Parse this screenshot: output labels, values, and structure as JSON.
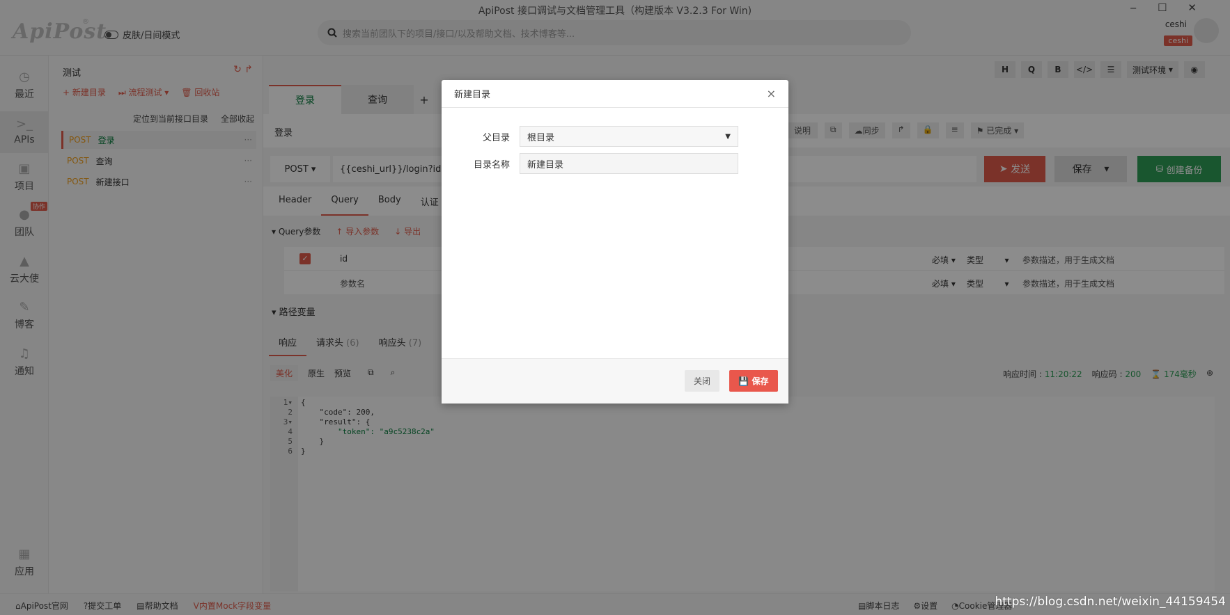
{
  "window": {
    "title": "ApiPost 接口调试与文档管理工具（构建版本 V3.2.3 For Win)",
    "controls": [
      "‒",
      "☐",
      "✕"
    ]
  },
  "header": {
    "logo": "ApiPost",
    "logo_mark": "®",
    "skin_toggle": "皮肤/日间模式",
    "search_placeholder": "搜索当前团队下的项目/接口/以及帮助文档、技术博客等...",
    "username": "ceshi",
    "team_badge": "ceshi"
  },
  "nav": {
    "items": [
      {
        "label": "最近",
        "icon": "clock-icon"
      },
      {
        "label": "APIs",
        "icon": "terminal-icon"
      },
      {
        "label": "项目",
        "icon": "project-icon"
      },
      {
        "label": "团队",
        "icon": "team-icon",
        "badge": "协作"
      },
      {
        "label": "云大使",
        "icon": "graduation-icon"
      },
      {
        "label": "博客",
        "icon": "edit-icon"
      },
      {
        "label": "通知",
        "icon": "bell-icon"
      },
      {
        "label": "应用",
        "icon": "apps-icon"
      }
    ]
  },
  "tree": {
    "title": "测试",
    "actions": [
      "+ 新建目录",
      "⏭ 流程测试 ▾",
      "🗑 回收站"
    ],
    "locate": "定位到当前接口目录",
    "collapse": "全部收起",
    "apis": [
      {
        "method": "POST",
        "name": "登录"
      },
      {
        "method": "POST",
        "name": "查询"
      },
      {
        "method": "POST",
        "name": "新建接口"
      }
    ]
  },
  "main": {
    "tabs": [
      "登录",
      "查询",
      "+"
    ],
    "api_name": "登录",
    "toolbar_icons": [
      "H",
      "Q",
      "B",
      "</>",
      "☰"
    ],
    "env_select": "测试环境",
    "right_tools": [
      "说明",
      "同步",
      "已完成"
    ],
    "method": "POST",
    "url": "{{ceshi_url}}/login?id=1",
    "send_label": "发送",
    "save_label": "保存",
    "backup_label": "创建备份",
    "req_tabs": [
      "Header",
      "Query",
      "Body",
      "认证"
    ],
    "query_section": "Query参数",
    "import_params": "导入参数",
    "export_params": "导出",
    "params": [
      {
        "key": "id",
        "required": "必填",
        "type": "类型",
        "desc": "参数描述，用于生成文档",
        "checked": true
      },
      {
        "key": "参数名",
        "required": "必填",
        "type": "类型",
        "desc": "参数描述，用于生成文档",
        "checked": false
      }
    ],
    "path_vars": "路径变量",
    "resp_tabs": [
      {
        "label": "响应"
      },
      {
        "label": "请求头",
        "count": "(6)"
      },
      {
        "label": "响应头",
        "count": "(7)"
      }
    ],
    "resp_views": [
      "美化",
      "原生",
      "预览"
    ],
    "resp_time_label": "响应时间 : ",
    "resp_time": "11:20:22",
    "resp_code_label": "响应码 : ",
    "resp_code": "200",
    "resp_ms": "174毫秒",
    "code_lines": [
      "{",
      "    \"code\": 200,",
      "    \"result\": {",
      "        \"token\": \"a9c5238c2a\"",
      "    }",
      "}"
    ]
  },
  "modal": {
    "title": "新建目录",
    "close_symbol": "×",
    "parent_label": "父目录",
    "parent_value": "根目录",
    "name_label": "目录名称",
    "name_value": "新建目录",
    "close_btn": "关闭",
    "save_btn": "保存"
  },
  "statusbar": {
    "left": [
      "ApiPost官网",
      "提交工单",
      "帮助文档",
      "内置Mock字段变量"
    ],
    "right": [
      "脚本日志",
      "设置",
      "Cookie管理器"
    ],
    "watermark": "https://blog.csdn.net/weixin_44159454"
  }
}
